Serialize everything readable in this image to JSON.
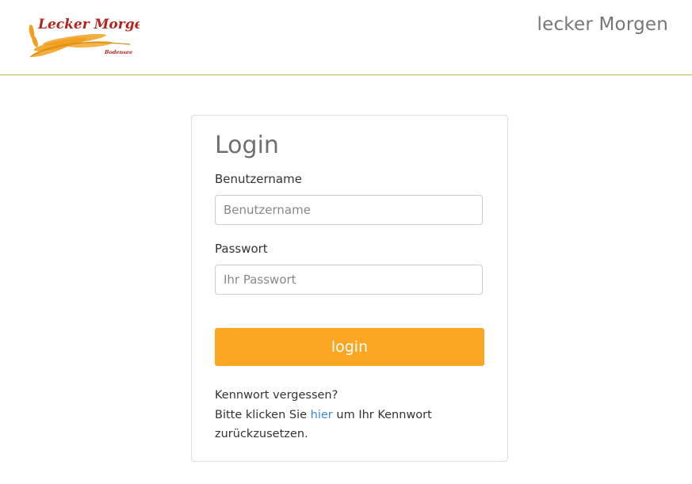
{
  "header": {
    "logo": {
      "text": "Lecker Morgen",
      "subtext": "Bodensee"
    },
    "brand": "lecker Morgen"
  },
  "login": {
    "title": "Login",
    "username_label": "Benutzername",
    "username_placeholder": "Benutzername",
    "username_value": "",
    "password_label": "Passwort",
    "password_placeholder": "Ihr Passwort",
    "password_value": "",
    "submit_label": "login",
    "forgot_question": "Kennwort vergessen?",
    "forgot_text_before": "Bitte klicken Sie ",
    "forgot_link": "hier",
    "forgot_text_after": " um Ihr Kennwort zurückzusetzen."
  },
  "colors": {
    "accent": "#fba724",
    "link": "#3b8ad8",
    "header_border": "#d2b06a",
    "logo_red": "#b3251f",
    "logo_gold": "#f0a020"
  },
  "icons": {
    "logo": "wheat-logo-icon"
  }
}
